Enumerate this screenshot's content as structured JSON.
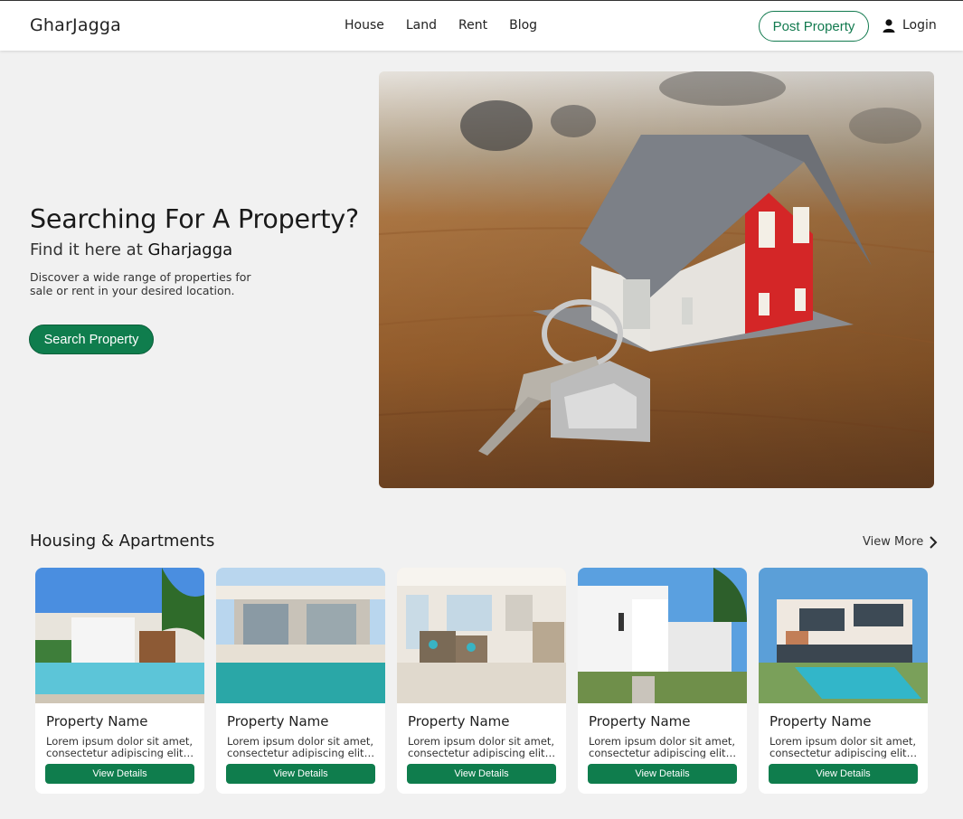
{
  "nav": {
    "brand": "GharJagga",
    "links": [
      "House",
      "Land",
      "Rent",
      "Blog"
    ],
    "post_property_label": "Post Property",
    "login_label": "Login",
    "login_icon": "user-icon"
  },
  "hero": {
    "title": "Searching For A Property?",
    "subtitle_prefix": "Find it here at ",
    "subtitle_brand": "Gharjagga",
    "description_line1": "Discover a wide range of properties for",
    "description_line2": "sale or rent in your desired location.",
    "search_button_label": "Search Property",
    "image": "house-model-with-keys"
  },
  "section": {
    "title": "Housing & Apartments",
    "view_more_label": "View More",
    "view_more_icon": "chevron-right-icon"
  },
  "cards": [
    {
      "name": "Property Name",
      "desc_line1": "Lorem ipsum dolor sit amet,",
      "desc_line2": "consectetur adipiscing elit,...",
      "button": "View Details",
      "image": "villa-with-pool-and-palm"
    },
    {
      "name": "Property Name",
      "desc_line1": "Lorem ipsum dolor sit amet,",
      "desc_line2": "consectetur adipiscing elit,...",
      "button": "View Details",
      "image": "modern-patio-pool"
    },
    {
      "name": "Property Name",
      "desc_line1": "Lorem ipsum dolor sit amet,",
      "desc_line2": "consectetur adipiscing elit,...",
      "button": "View Details",
      "image": "living-room-interior"
    },
    {
      "name": "Property Name",
      "desc_line1": "Lorem ipsum dolor sit amet,",
      "desc_line2": "consectetur adipiscing elit,...",
      "button": "View Details",
      "image": "white-modern-house"
    },
    {
      "name": "Property Name",
      "desc_line1": "Lorem ipsum dolor sit amet,",
      "desc_line2": "consectetur adipiscing elit,...",
      "button": "View Details",
      "image": "modern-house-with-pool"
    }
  ],
  "colors": {
    "accent": "#0f7d4d",
    "background": "#f1f1f1",
    "navbar": "#ffffff"
  }
}
